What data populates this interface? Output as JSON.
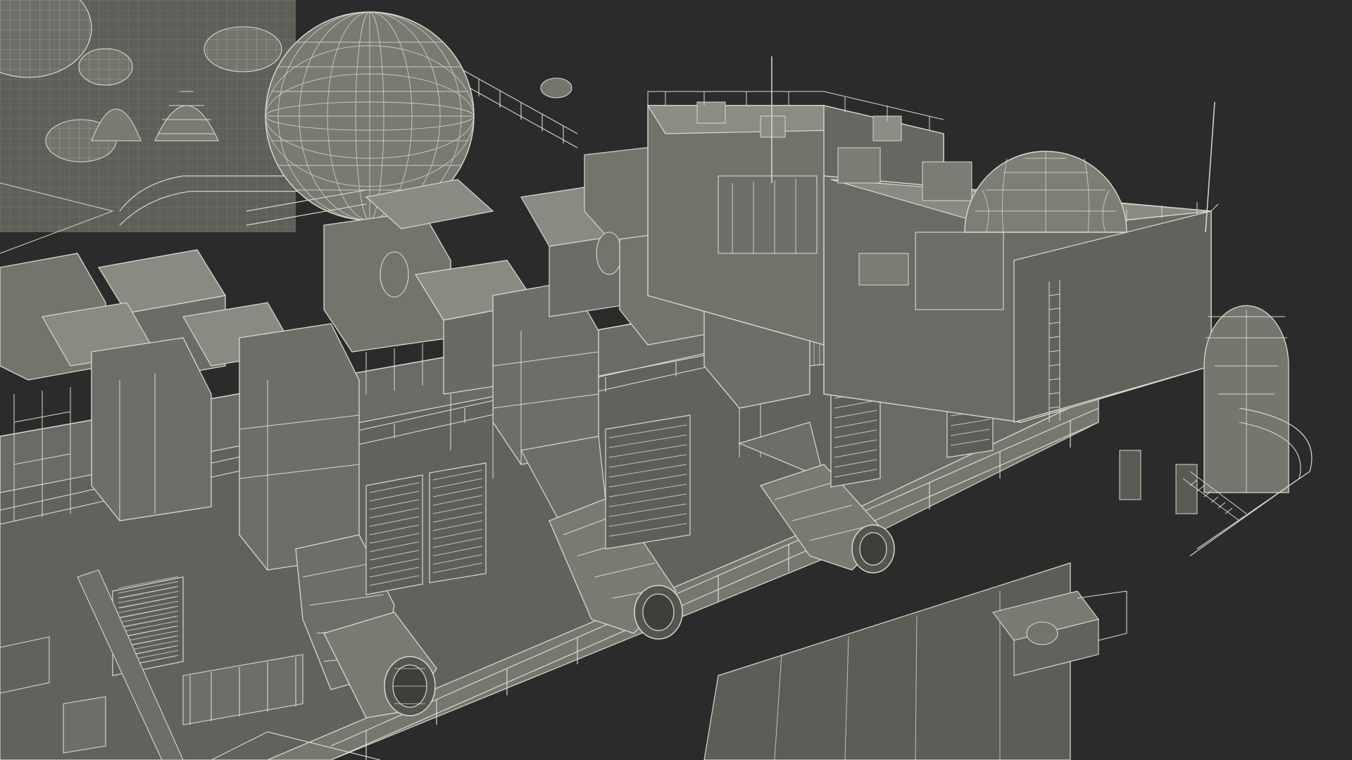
{
  "scene": {
    "subject": "offshore-platform-wireframe",
    "colors": {
      "background": "#2b2b2b",
      "surface": "#6e6e68",
      "surface_light": "#8a8a83",
      "surface_dark": "#55554f",
      "wire": "#d9d9cf",
      "wire_dim": "#a9a99f"
    }
  }
}
